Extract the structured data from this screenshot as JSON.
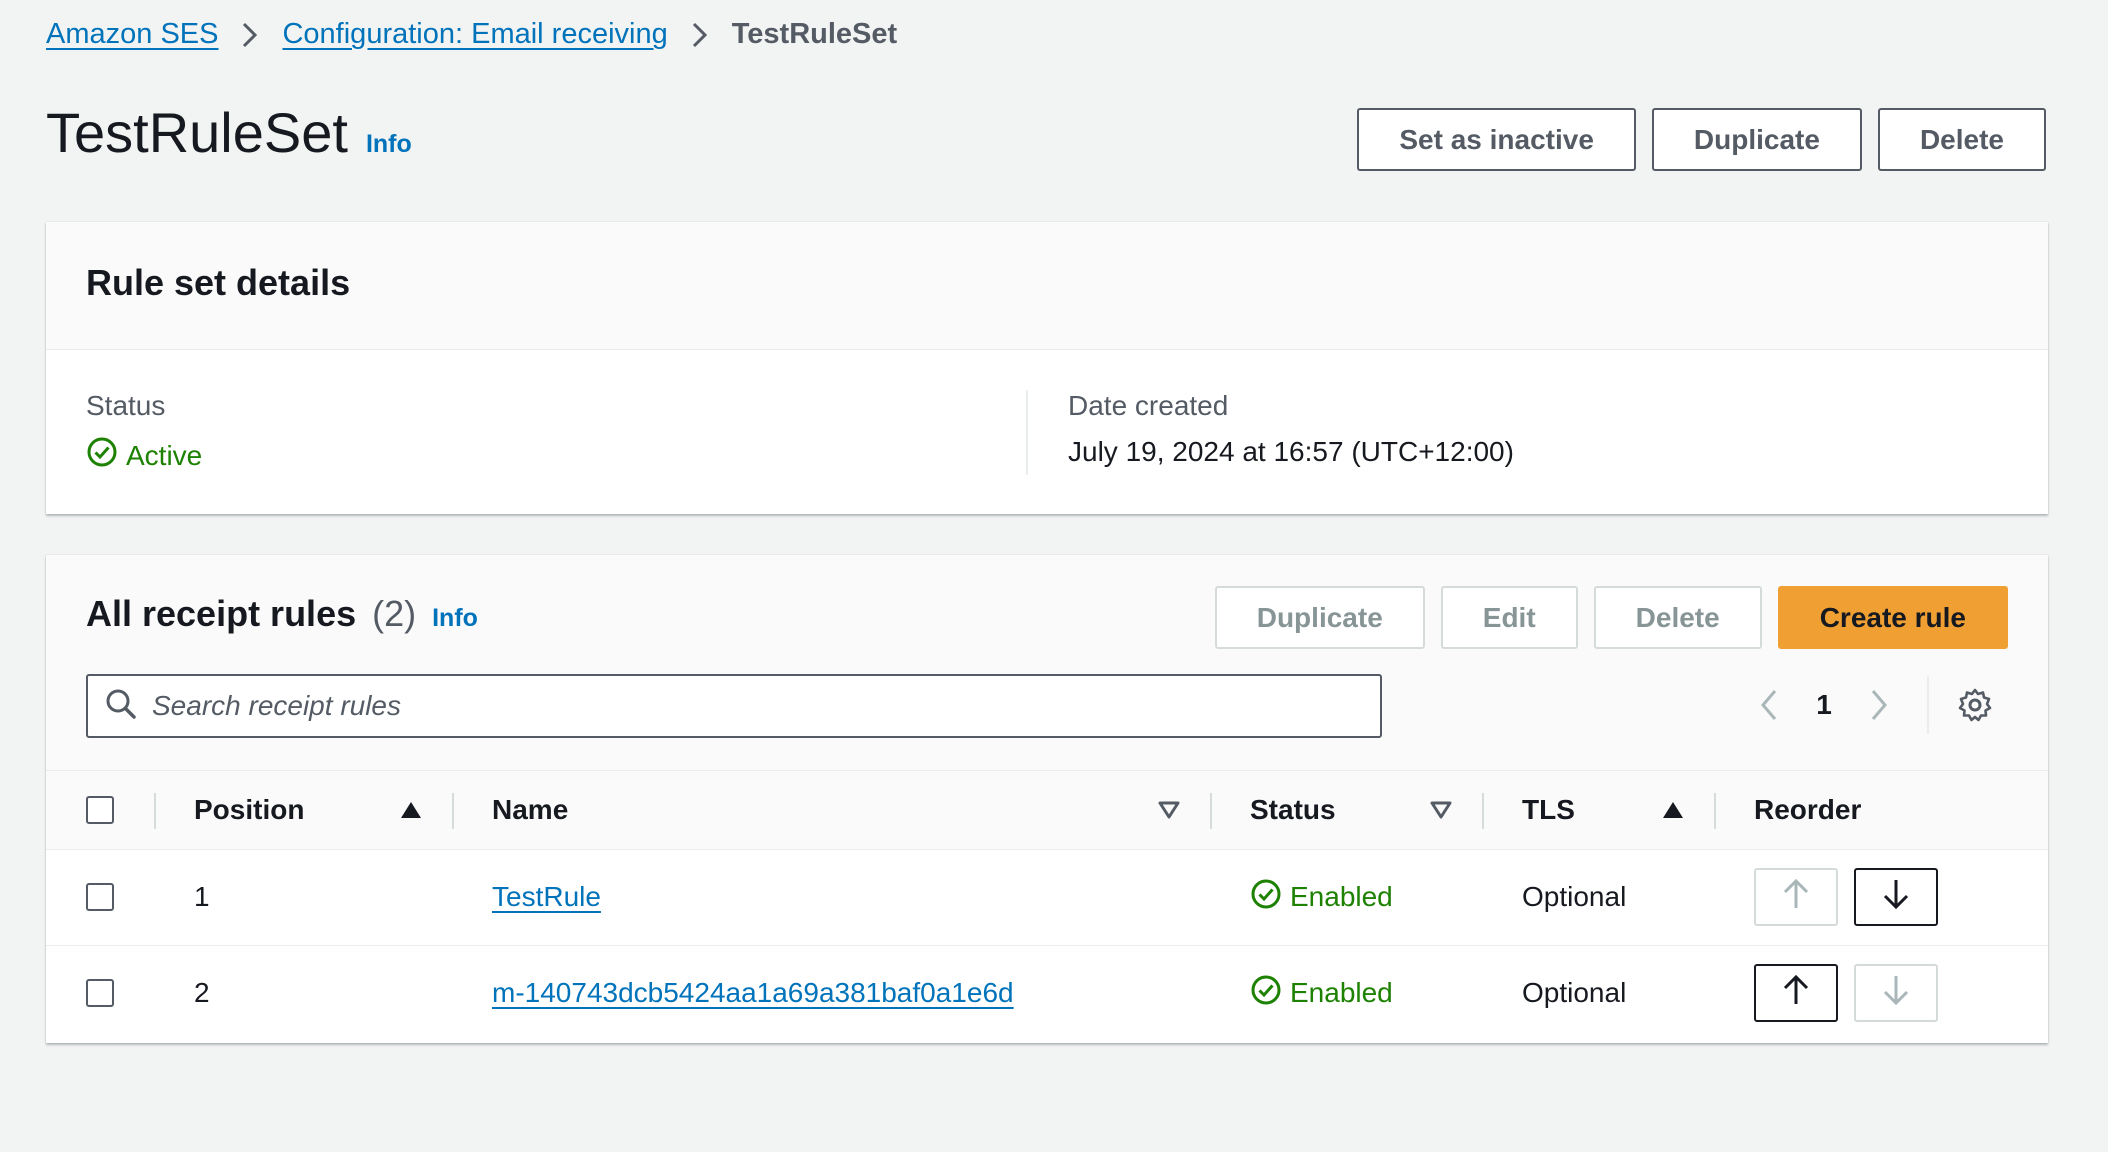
{
  "breadcrumb": {
    "items": [
      "Amazon SES",
      "Configuration: Email receiving",
      "TestRuleSet"
    ]
  },
  "header": {
    "title": "TestRuleSet",
    "info": "Info",
    "actions": {
      "set_inactive": "Set as inactive",
      "duplicate": "Duplicate",
      "delete": "Delete"
    }
  },
  "details": {
    "title": "Rule set details",
    "status_label": "Status",
    "status_value": "Active",
    "date_label": "Date created",
    "date_value": "July 19, 2024 at 16:57 (UTC+12:00)"
  },
  "rules": {
    "title": "All receipt rules",
    "count": "(2)",
    "info": "Info",
    "actions": {
      "duplicate": "Duplicate",
      "edit": "Edit",
      "delete": "Delete",
      "create": "Create rule"
    },
    "search_placeholder": "Search receipt rules",
    "page": "1",
    "columns": {
      "position": "Position",
      "name": "Name",
      "status": "Status",
      "tls": "TLS",
      "reorder": "Reorder"
    },
    "rows": [
      {
        "position": "1",
        "name": "TestRule",
        "status": "Enabled",
        "tls": "Optional"
      },
      {
        "position": "2",
        "name": "m-140743dcb5424aa1a69a381baf0a1e6d",
        "status": "Enabled",
        "tls": "Optional"
      }
    ]
  },
  "colors": {
    "link": "#0073bb",
    "success": "#1d8102",
    "primary": "#f0a033",
    "background": "#f2f3f3"
  }
}
